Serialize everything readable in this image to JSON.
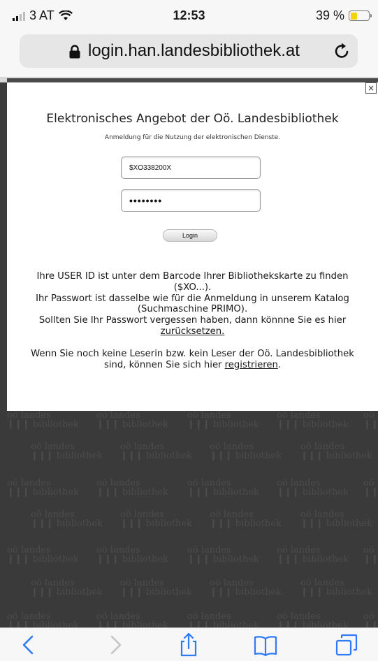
{
  "status_bar": {
    "carrier": "3 AT",
    "time": "12:53",
    "battery_percent": "39 %",
    "battery_level": 0.39,
    "battery_color": "#f5d300"
  },
  "address_bar": {
    "url": "login.han.landesbibliothek.at",
    "lock_icon": "lock-icon",
    "reload_icon": "reload-icon"
  },
  "dialog": {
    "close_label": "×",
    "title": "Elektronisches Angebot der Oö. Landesbibliothek",
    "subtitle": "Anmeldung für die Nutzung der elektronischen Dienste.",
    "user_id_value": "$XO338200X",
    "password_value": "••••••••",
    "login_button": "Login",
    "info_line1": "Ihre USER ID ist unter dem Barcode Ihrer Bibliothekskarte zu finden",
    "info_line2": "($XO...).",
    "info_line3": "Ihr Passwort ist dasselbe wie für die Anmeldung in unserem Katalog",
    "info_line4": "(Suchmaschine PRIMO).",
    "info_line5": "Sollten Sie Ihr Passwort vergessen haben, dann könnne Sie es hier",
    "reset_link": "zurücksetzen.",
    "register_line1": "Wenn Sie noch keine Leserin bzw. kein Leser der Oö. Landesbibliothek",
    "register_line2_prefix": "sind, können Sie sich hier ",
    "register_link": "registrieren",
    "register_line2_suffix": "."
  },
  "watermark": {
    "line1": "oö landes",
    "line2": "bibliothek"
  },
  "toolbar": {
    "back_icon": "back-icon",
    "forward_icon": "forward-icon",
    "share_icon": "share-icon",
    "bookmarks_icon": "bookmarks-icon",
    "tabs_icon": "tabs-icon",
    "accent": "#2f7bf6"
  }
}
